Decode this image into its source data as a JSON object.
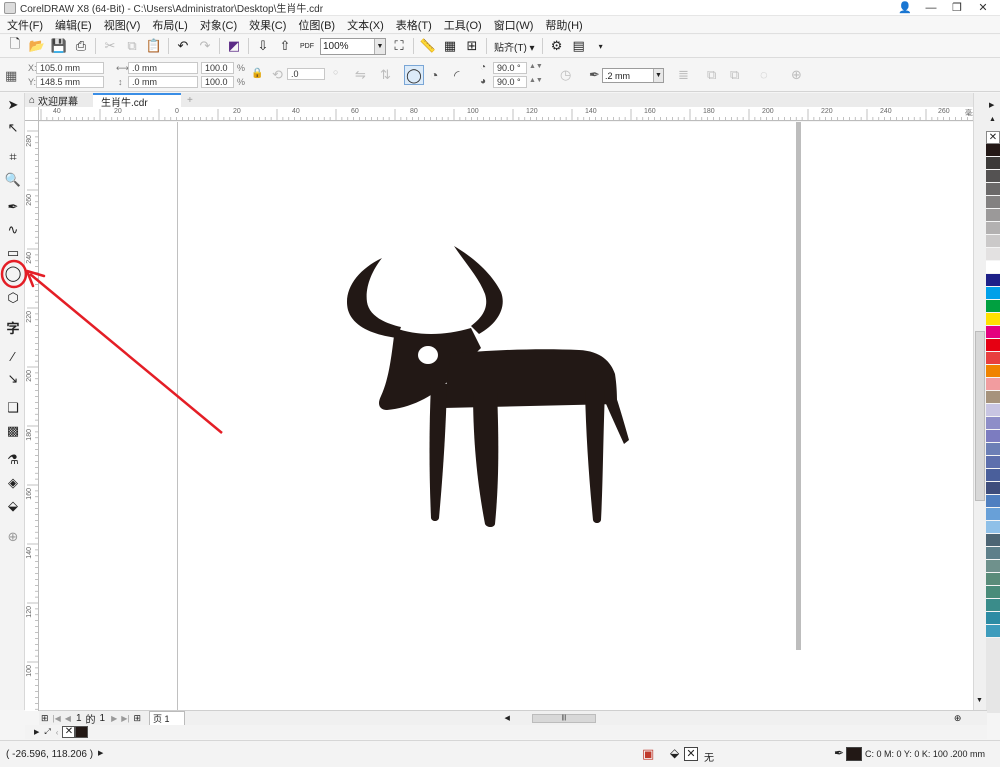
{
  "window": {
    "title": "CorelDRAW X8 (64-Bit) - C:\\Users\\Administrator\\Desktop\\生肖牛.cdr"
  },
  "menu": [
    "文件(F)",
    "编辑(E)",
    "视图(V)",
    "布局(L)",
    "对象(C)",
    "效果(C)",
    "位图(B)",
    "文本(X)",
    "表格(T)",
    "工具(O)",
    "窗口(W)",
    "帮助(H)"
  ],
  "toolbar": {
    "zoom": "100%",
    "snap_label": "贴齐(T)",
    "pdf_label": "PDF"
  },
  "property_bar": {
    "x": "105.0 mm",
    "y": "148.5 mm",
    "w": ".0 mm",
    "h": ".0 mm",
    "scale_w": "100.0",
    "scale_h": "100.0",
    "pct": "%",
    "rotation": ".0",
    "start_angle": "90.0 °",
    "end_angle": "90.0 °",
    "outline": ".2 mm"
  },
  "tabs": [
    "欢迎屏幕",
    "生肖牛.cdr"
  ],
  "ruler": {
    "h": [
      "40",
      "20",
      "0",
      "20",
      "40",
      "60",
      "80",
      "100",
      "120",
      "140",
      "160",
      "180",
      "200",
      "220",
      "240",
      "260"
    ],
    "unit": "毫米",
    "v": [
      "280",
      "260",
      "240",
      "220",
      "200",
      "180",
      "160",
      "140",
      "120",
      "100",
      "80"
    ]
  },
  "page_nav": {
    "page": "1",
    "of": "的",
    "total": "1",
    "tab": "页 1"
  },
  "status": {
    "coords": "( -26.596, 118.206 )",
    "fill": "无",
    "cmyk": "C: 0 M: 0 Y: 0 K: 100",
    "width": ".200 mm"
  },
  "colors": {
    "accent": "#3a8ee6",
    "annotation": "#e41e26",
    "ox": "#221815"
  },
  "palette": [
    "#231816",
    "#3c3a39",
    "#545252",
    "#6b6969",
    "#838181",
    "#9b9999",
    "#b3b1b1",
    "#cbc9c9",
    "#e3e1e1",
    "#ffffff",
    "#1d2088",
    "#00a0e9",
    "#00a040",
    "#ffe100",
    "#e4007f",
    "#e60012",
    "#e83f3f",
    "#f08300",
    "#f29c9f",
    "#a6937c",
    "#c8c5e2",
    "#8e8ec8",
    "#7c7cc0",
    "#6c7fb6",
    "#5d6fad",
    "#4a5f9b",
    "#3e4d7c",
    "#4f7fc0",
    "#68a0d8",
    "#8fc0e8",
    "#4d6574",
    "#5e7f8a",
    "#6f918c",
    "#5a8c7a",
    "#4a8c7a",
    "#3a8c8a",
    "#2d8ca4",
    "#3e9cbc"
  ],
  "icons": {
    "circled_tool": "ellipse-icon"
  }
}
